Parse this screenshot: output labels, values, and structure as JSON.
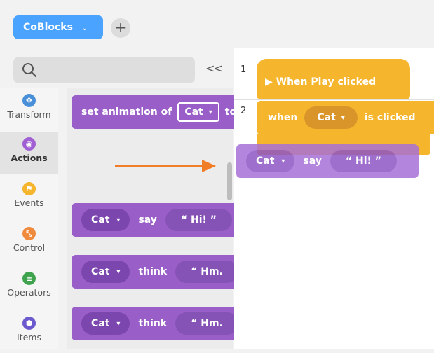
{
  "header": {
    "project_label": "CoBlocks",
    "project_chevron": "⌄",
    "add_label": "+"
  },
  "search": {
    "collapse_label": "<<"
  },
  "categories": [
    {
      "label": "Transform",
      "color": "#4a90d9",
      "icon": "transform-icon"
    },
    {
      "label": "Actions",
      "color": "#a05fd3",
      "icon": "eye-icon"
    },
    {
      "label": "Events",
      "color": "#f5b52d",
      "icon": "flag-icon"
    },
    {
      "label": "Control",
      "color": "#f08a3c",
      "icon": "control-icon"
    },
    {
      "label": "Operators",
      "color": "#3fa34d",
      "icon": "plus-minus-icon"
    },
    {
      "label": "Items",
      "color": "#6a5acd",
      "icon": "cube-icon"
    }
  ],
  "palette": {
    "set_anim": {
      "prefix": "set animation of",
      "target": "Cat",
      "suffix": "to"
    },
    "say": {
      "actor": "Cat",
      "verb": "say",
      "text": "“ Hi! ”"
    },
    "think1": {
      "actor": "Cat",
      "verb": "think",
      "text": "“ Hm."
    },
    "think2": {
      "actor": "Cat",
      "verb": "think",
      "text": "“ Hm."
    }
  },
  "workspace": {
    "line1": "1",
    "line2": "2",
    "hat_label": "▶ When Play clicked",
    "event": {
      "when": "when",
      "actor": "Cat",
      "suffix": "is clicked"
    },
    "ghost": {
      "actor": "Cat",
      "verb": "say",
      "text": "“ Hi! ”"
    }
  },
  "colors": {
    "accent": "#4aa3ff",
    "actions": "#9a5ec9",
    "events": "#f5b52d",
    "arrow": "#f07d28"
  }
}
